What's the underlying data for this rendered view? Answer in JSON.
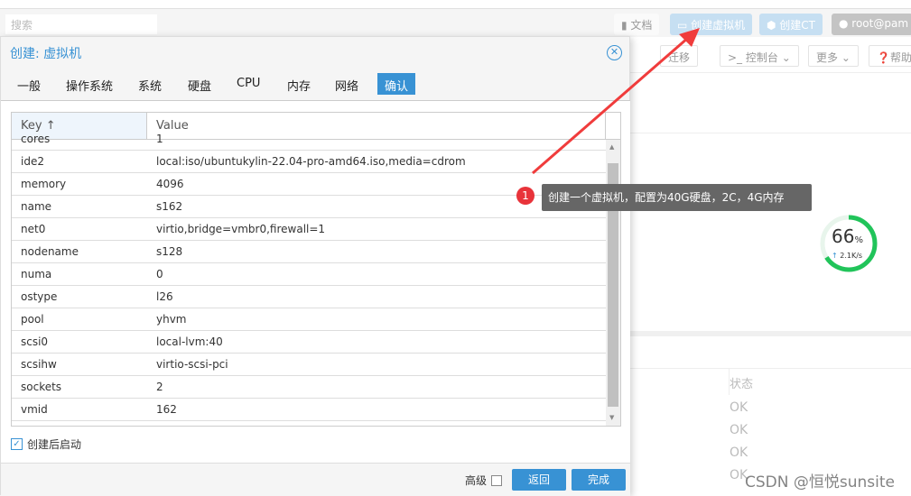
{
  "app": {
    "search_placeholder": "搜索",
    "docs": "文档",
    "create_vm": "创建虚拟机",
    "create_ct": "创建CT",
    "user": "root@pam",
    "toolbar": {
      "migrate": "迁移",
      "console": "控制台",
      "more": "更多",
      "help": "帮助"
    },
    "status_header": "状态",
    "status_rows": [
      "OK",
      "OK",
      "OK",
      "OK"
    ],
    "gauge": {
      "percent": "66",
      "unit": "%",
      "rate": "2.1K/s",
      "value": 0.66,
      "color": "#21c45a"
    }
  },
  "dialog": {
    "title": "创建: 虚拟机",
    "tabs": [
      "一般",
      "操作系统",
      "系统",
      "硬盘",
      "CPU",
      "内存",
      "网络",
      "确认"
    ],
    "active_tab": 7,
    "grid": {
      "col_key": "Key",
      "col_value": "Value",
      "rows": [
        [
          "cores",
          "1"
        ],
        [
          "ide2",
          "local:iso/ubuntukylin-22.04-pro-amd64.iso,media=cdrom"
        ],
        [
          "memory",
          "4096"
        ],
        [
          "name",
          "s162"
        ],
        [
          "net0",
          "virtio,bridge=vmbr0,firewall=1"
        ],
        [
          "nodename",
          "s128"
        ],
        [
          "numa",
          "0"
        ],
        [
          "ostype",
          "l26"
        ],
        [
          "pool",
          "yhvm"
        ],
        [
          "scsi0",
          "local-lvm:40"
        ],
        [
          "scsihw",
          "virtio-scsi-pci"
        ],
        [
          "sockets",
          "2"
        ],
        [
          "vmid",
          "162"
        ]
      ]
    },
    "start_after": "创建后启动",
    "start_after_checked": true,
    "advanced": "高级",
    "back": "返回",
    "finish": "完成"
  },
  "annotation": {
    "number": "1",
    "text": "创建一个虚拟机，配置为40G硬盘，2C，4G内存"
  },
  "watermark": "CSDN @恒悦sunsite",
  "colors": {
    "accent": "#3892d4",
    "annotation": "#e8333a"
  }
}
